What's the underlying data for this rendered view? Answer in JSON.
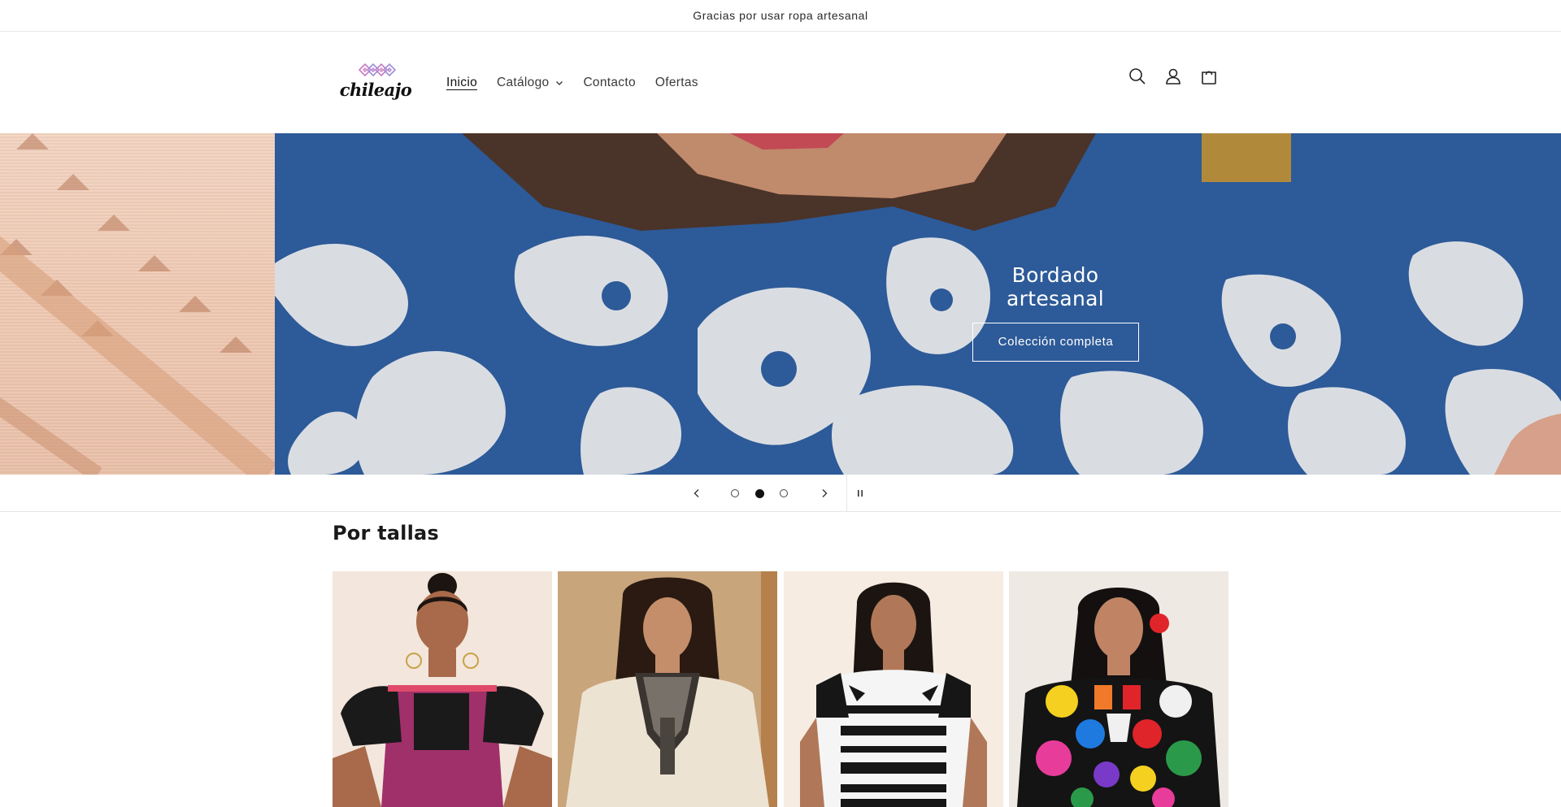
{
  "announcement": "Gracias por usar ropa artesanal",
  "logo_text": "chileajo",
  "nav": [
    {
      "label": "Inicio"
    },
    {
      "label": "Catálogo"
    },
    {
      "label": "Contacto"
    },
    {
      "label": "Ofertas"
    }
  ],
  "header_icons": [
    "search-icon",
    "account-icon",
    "cart-icon"
  ],
  "hero": {
    "title": "Bordado artesanal",
    "button": "Colección completa",
    "slides_total": 3,
    "active_slide": 2
  },
  "slider_controls": [
    "chevron-left-icon",
    "chevron-right-icon",
    "pause-icon"
  ],
  "section": {
    "title": "Por tallas",
    "cards_count": 4
  },
  "colors": {
    "hero_blue": "#2d5a98",
    "hero_left": "#efc9b3",
    "text": "#1f1f1f"
  }
}
